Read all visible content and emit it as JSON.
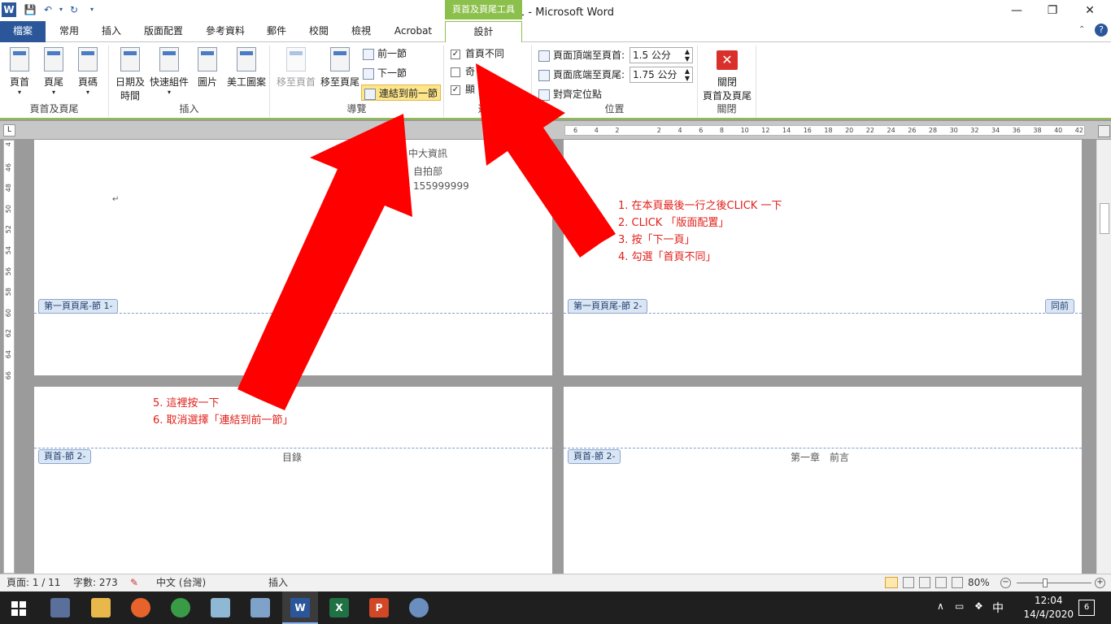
{
  "window": {
    "title": "文件1 - Microsoft Word",
    "context_tab_header": "頁首及頁尾工具",
    "minimize_glyph": "—",
    "restore_glyph": "❐",
    "close_glyph": "✕"
  },
  "tabs": [
    "檔案",
    "常用",
    "插入",
    "版面配置",
    "參考資料",
    "郵件",
    "校閱",
    "檢視",
    "Acrobat",
    "設計"
  ],
  "ribbon": {
    "groups": {
      "header_footer": {
        "label": "頁首及頁尾",
        "buttons": [
          "頁首",
          "頁尾",
          "頁碼"
        ]
      },
      "insert": {
        "label": "插入",
        "buttons": [
          "日期及\n時間",
          "快速組件",
          "圖片",
          "美工圖案"
        ]
      },
      "navigation": {
        "label": "導覽",
        "goto_header": "移至頁首",
        "goto_footer": "移至頁尾",
        "prev_section": "前一節",
        "next_section": "下一節",
        "link_to_previous": "連結到前一節"
      },
      "options": {
        "label": "選項",
        "first_page_different": "首頁不同",
        "odd_even_different": "奇",
        "show_document_text": "顯"
      },
      "position": {
        "label": "位置",
        "header_from_top_label": "頁面頂端至頁首:",
        "header_from_top_value": "1.5 公分",
        "footer_from_bottom_label": "頁面底端至頁尾:",
        "footer_from_bottom_value": "1.75 公分",
        "insert_alignment_tab": "對齊定位點"
      },
      "close": {
        "label": "關閉",
        "close_button": "關閉\n頁首及頁尾"
      }
    }
  },
  "ruler": {
    "h_ticks": [
      "6",
      "4",
      "2",
      "",
      "2",
      "4",
      "6",
      "8",
      "10",
      "12",
      "14",
      "16",
      "18",
      "20",
      "22",
      "24",
      "26",
      "28",
      "30",
      "32",
      "34",
      "36",
      "38",
      "40",
      "42"
    ],
    "v_ticks": [
      "4",
      "46",
      "48",
      "50",
      "52",
      "54",
      "56",
      "58",
      "60",
      "62",
      "64",
      "66"
    ]
  },
  "document": {
    "page1_lines": [
      "指導老師：中大資訊",
      "學生：自拍部",
      "學號：155999999"
    ],
    "footer_tag_1": "第一頁頁尾-節 1-",
    "footer_tag_2": "第一頁頁尾-節 2-",
    "same_as_previous": "同前",
    "header_tag_2a": "頁首-節 2-",
    "header_tag_2b": "頁首-節 2-",
    "toc": "目錄",
    "chapter1": "第一章　前言",
    "paragraph_mark": "↵"
  },
  "annotations": {
    "right": [
      "1. 在本頁最後一行之後CLICK 一下",
      "2. CLICK 「版面配置」",
      "3. 按「下一頁」",
      "4. 勾選「首頁不同」"
    ],
    "left": [
      "5. 這裡按一下",
      "6. 取消選擇「連結到前一節」"
    ],
    "arrow_color": "#ff0000"
  },
  "statusbar": {
    "page": "頁面: 1 / 11",
    "words": "字數: 273",
    "language": "中文 (台灣)",
    "mode": "插入",
    "zoom": "80%"
  },
  "taskbar": {
    "time": "12:04",
    "date": "14/4/2020",
    "ime": "中",
    "notifications": "6"
  }
}
